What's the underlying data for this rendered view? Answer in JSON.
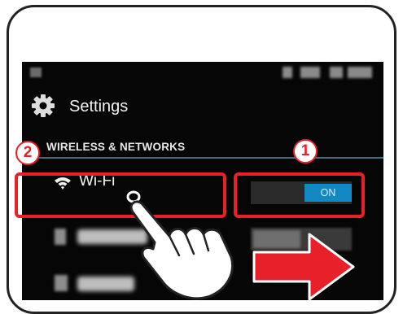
{
  "settings": {
    "title": "Settings",
    "section_header": "WIRELESS & NETWORKS",
    "wifi": {
      "label": "Wi-Fi",
      "toggle_state": "ON"
    }
  },
  "callouts": {
    "step_1": "1",
    "step_2": "2"
  },
  "icons": [
    "settings-gear-icon",
    "wifi-icon",
    "pointing-hand-icon",
    "right-arrow-icon"
  ],
  "colors": {
    "highlight": "#e8202a",
    "toggle_on": "#1289c3",
    "section_divider": "#3a6f85"
  }
}
